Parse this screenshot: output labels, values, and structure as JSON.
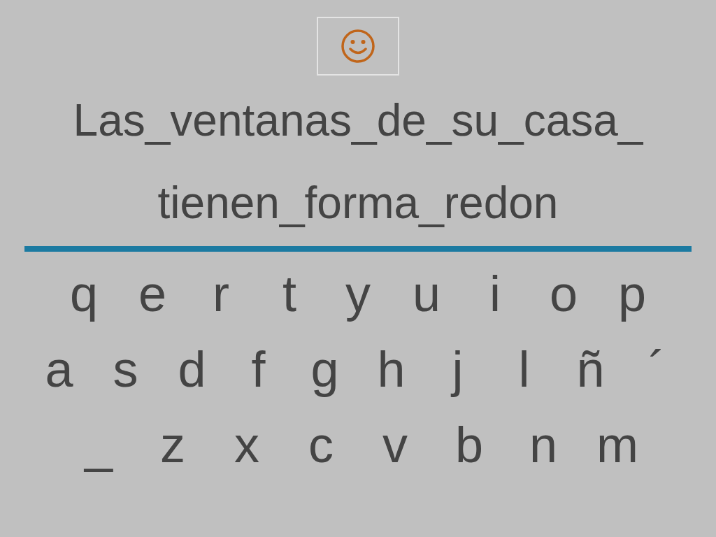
{
  "sentence_lines": [
    "Las_ventanas_de_su_casa_",
    "tienen_forma_redon"
  ],
  "keyboard_rows": [
    [
      "q",
      "e",
      "r",
      "t",
      "y",
      "u",
      "i",
      "o",
      "p"
    ],
    [
      "a",
      "s",
      "d",
      "f",
      "g",
      "h",
      "j",
      "l",
      "ñ",
      "´"
    ],
    [
      "_",
      "z",
      "x",
      "c",
      "v",
      "b",
      "n",
      "m"
    ]
  ]
}
